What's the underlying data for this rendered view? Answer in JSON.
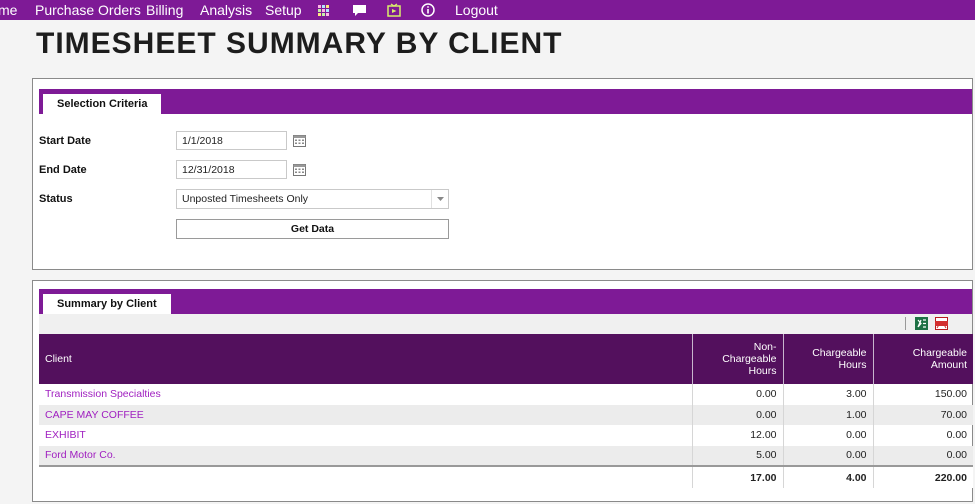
{
  "nav": {
    "items": [
      "me",
      "Purchase Orders",
      "Billing",
      "Analysis",
      "Setup"
    ],
    "logout": "Logout",
    "icons": [
      "grid-icon",
      "chat-icon",
      "video-icon",
      "info-icon"
    ]
  },
  "page": {
    "title": "TIMESHEET SUMMARY BY CLIENT"
  },
  "criteria": {
    "tab": "Selection Criteria",
    "start_label": "Start Date",
    "start_value": "1/1/2018",
    "end_label": "End Date",
    "end_value": "12/31/2018",
    "status_label": "Status",
    "status_value": "Unposted Timesheets Only",
    "button": "Get Data"
  },
  "summary": {
    "tab": "Summary by Client",
    "columns": [
      "Client",
      "Non-\nChargeable\nHours",
      "Chargeable\nHours",
      "Chargeable\nAmount"
    ],
    "rows": [
      [
        "Transmission Specialties",
        "0.00",
        "3.00",
        "150.00"
      ],
      [
        "CAPE MAY COFFEE",
        "0.00",
        "1.00",
        "70.00"
      ],
      [
        "EXHIBIT",
        "12.00",
        "0.00",
        "0.00"
      ],
      [
        "Ford Motor Co.",
        "5.00",
        "0.00",
        "0.00"
      ]
    ],
    "totals": [
      "",
      "17.00",
      "4.00",
      "220.00"
    ]
  },
  "colors": {
    "nav_bg": "#7e1a96",
    "header_bg": "#53105d",
    "link": "#a020c0",
    "excel": "#1e7145",
    "pdf": "#d32f2f"
  }
}
